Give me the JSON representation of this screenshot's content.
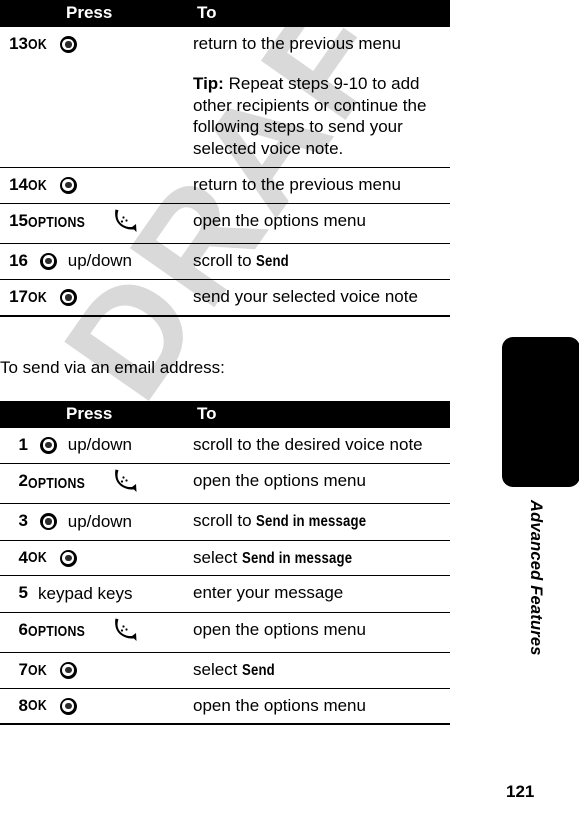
{
  "page": {
    "number": "121",
    "chapter": "Advanced Features",
    "watermark": "DRAFT"
  },
  "icons": {
    "nav_key": "nav-wheel-icon",
    "soft_key": "soft-key-icon"
  },
  "table1": {
    "headers": {
      "num": "",
      "press": "Press",
      "to": "To"
    },
    "rows": [
      {
        "num": "13",
        "press_key": "OK",
        "press_icon": "nav-wheel-icon",
        "to": "return to the previous menu",
        "note_label": "Tip:",
        "note_text": " Repeat steps 9-10 to add other recipients or continue the following steps to send your selected voice note."
      },
      {
        "num": "14",
        "press_key": "OK",
        "press_icon": "nav-wheel-icon",
        "to": "return to the previous menu"
      },
      {
        "num": "15",
        "press_key": "OPTIONS",
        "press_icon": "soft-key-icon",
        "to": "open the options menu"
      },
      {
        "num": "16",
        "press_key": "up/down",
        "press_icon": "nav-wheel-icon",
        "to": "scroll to ",
        "to_menu": "Send"
      },
      {
        "num": "17",
        "press_key": "OK",
        "press_icon": "nav-wheel-icon",
        "to": "send your selected voice note"
      }
    ]
  },
  "intro": {
    "text": "To send via an email address:"
  },
  "table2": {
    "headers": {
      "num": "",
      "press": "Press",
      "to": "To"
    },
    "rows": [
      {
        "num": "1",
        "press_key": "up/down",
        "press_icon": "nav-wheel-icon",
        "to": "scroll to the desired voice note"
      },
      {
        "num": "2",
        "press_key": "OPTIONS",
        "press_icon": "soft-key-icon",
        "to": "open the options menu"
      },
      {
        "num": "3",
        "press_key": "up/down",
        "press_icon": "nav-wheel-icon",
        "to": "scroll to ",
        "to_menu": "Send in message"
      },
      {
        "num": "4",
        "press_key": "OK",
        "press_icon": "nav-wheel-icon",
        "to": "select ",
        "to_menu": "Send in message"
      },
      {
        "num": "5",
        "press_key": "keypad keys",
        "press_icon": "",
        "to": "enter your message"
      },
      {
        "num": "6",
        "press_key": "OPTIONS",
        "press_icon": "soft-key-icon",
        "to": "open the options menu"
      },
      {
        "num": "7",
        "press_key": "OK",
        "press_icon": "nav-wheel-icon",
        "to": "select ",
        "to_menu": "Send"
      },
      {
        "num": "8",
        "press_key": "OK",
        "press_icon": "nav-wheel-icon",
        "to": "open the options menu"
      }
    ]
  },
  "colors": {
    "header_bg": "#000000",
    "header_fg": "#ffffff",
    "rule": "#000000",
    "watermark": "#d9d9d9",
    "page_bg": "#ffffff"
  }
}
